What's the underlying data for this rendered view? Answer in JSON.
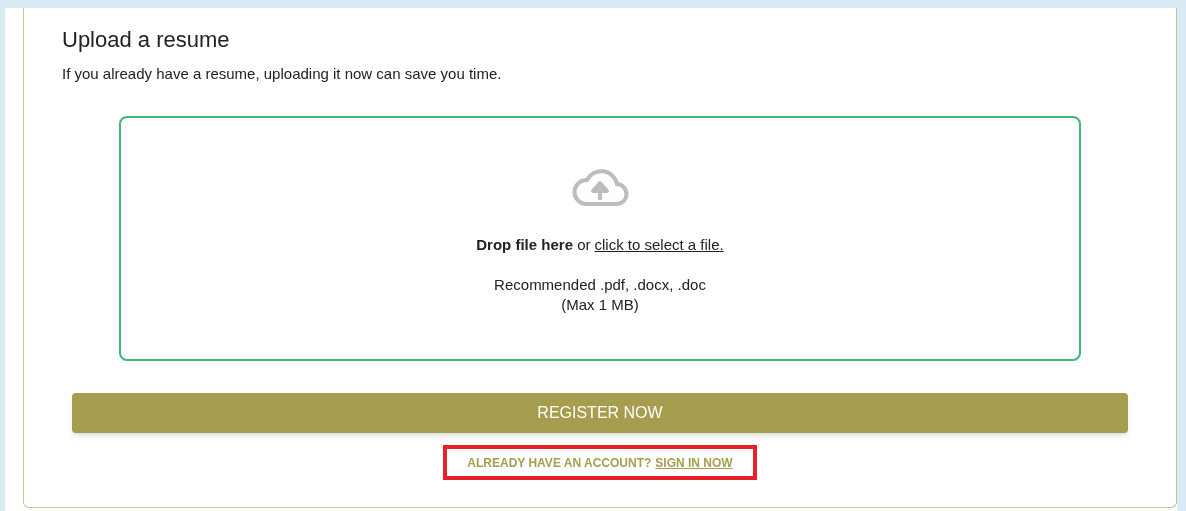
{
  "section": {
    "title": "Upload a resume",
    "description": "If you already have a resume, uploading it now can save you time."
  },
  "dropzone": {
    "instruction": "**Drop file here** or",
    "link": "click to select a file.",
    "formats": "Recommended .pdf, .docx, .doc",
    "limit": "(Max 1 MB)"
  },
  "register_button": {
    "label": "REGISTER NOW"
  },
  "sign_in": {
    "prompt": "ALREADY HAVE AN ACCOUNT?",
    "link": "SIGN IN NOW",
    "highlighted": true
  }
}
